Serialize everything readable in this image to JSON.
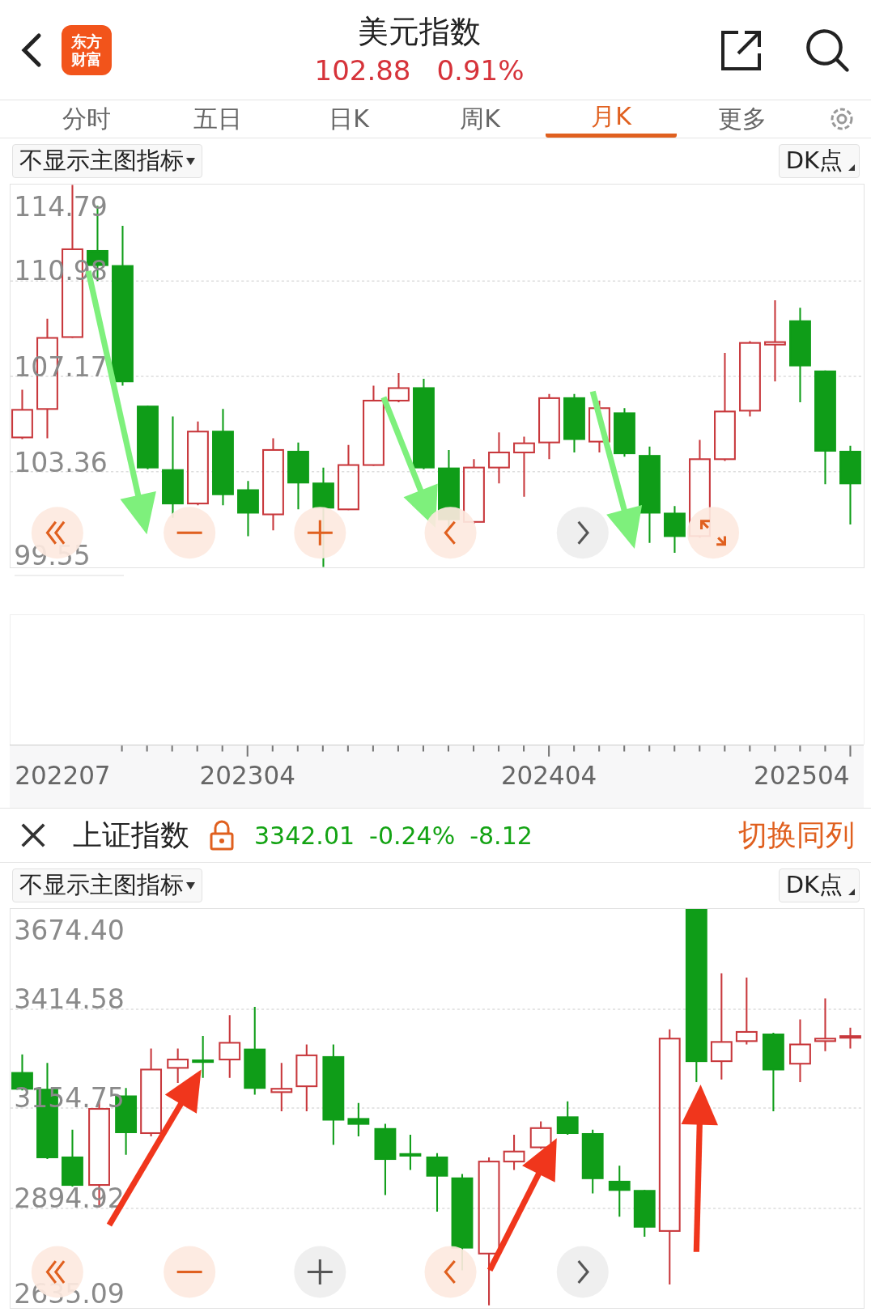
{
  "header": {
    "logo_lines": [
      "东方",
      "财富"
    ],
    "title": "美元指数",
    "price": "102.88",
    "change_pct": "0.91%"
  },
  "tabs": [
    {
      "label": "分时",
      "selected": false
    },
    {
      "label": "五日",
      "selected": false
    },
    {
      "label": "日K",
      "selected": false
    },
    {
      "label": "周K",
      "selected": false
    },
    {
      "label": "月K",
      "selected": true
    },
    {
      "label": "更多",
      "selected": false
    }
  ],
  "main_panel": {
    "indicator_select": "不显示主图指标",
    "dk_button": "DK点",
    "y_labels": [
      "114.79",
      "110.98",
      "107.17",
      "103.36",
      "99.55"
    ],
    "controls": [
      {
        "kind": "first",
        "enabled": true
      },
      {
        "kind": "zoom_out",
        "enabled": true
      },
      {
        "kind": "zoom_in",
        "enabled": true
      },
      {
        "kind": "prev",
        "enabled": true
      },
      {
        "kind": "next",
        "enabled": false
      },
      {
        "kind": "fullscreen",
        "enabled": true
      }
    ],
    "x_labels": [
      "202207",
      "202304",
      "202404",
      "202504"
    ]
  },
  "compare_bar": {
    "name": "上证指数",
    "locked": true,
    "price": "3342.01",
    "change_pct": "-0.24%",
    "change": "-8.12",
    "switch_label": "切换同列"
  },
  "compare_panel": {
    "indicator_select": "不显示主图指标",
    "dk_button": "DK点",
    "y_labels": [
      "3674.40",
      "3414.58",
      "3154.75",
      "2894.92",
      "2635.09"
    ],
    "controls": [
      {
        "kind": "first",
        "enabled": true
      },
      {
        "kind": "zoom_out",
        "enabled": true
      },
      {
        "kind": "zoom_in",
        "enabled": false
      },
      {
        "kind": "prev",
        "enabled": true
      },
      {
        "kind": "next",
        "enabled": false
      }
    ]
  }
}
